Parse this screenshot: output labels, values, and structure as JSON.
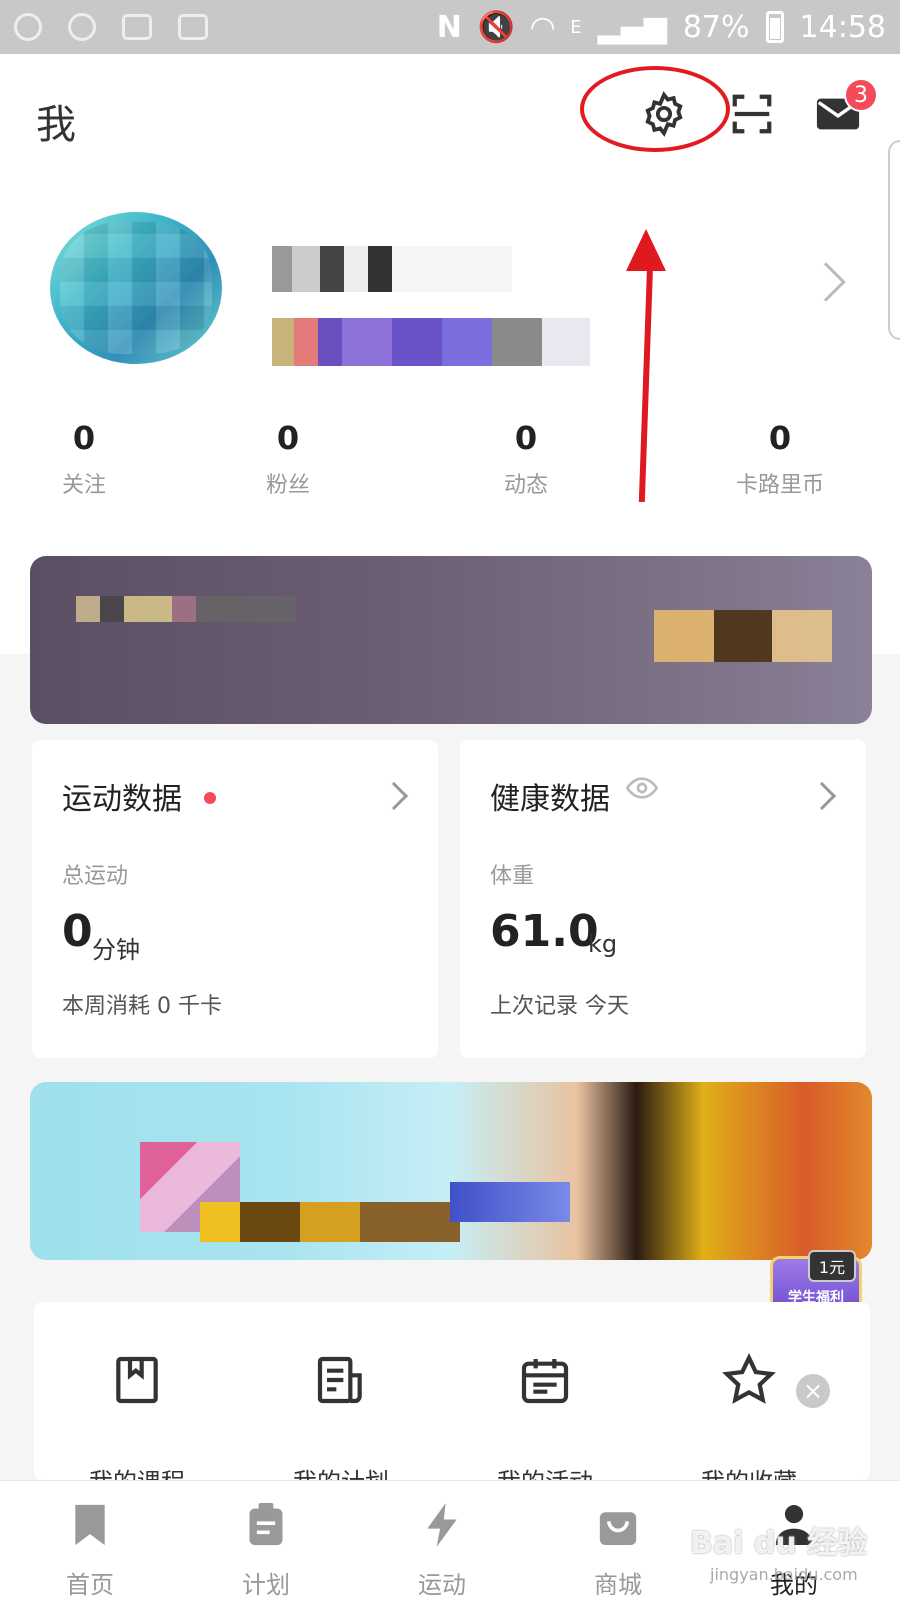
{
  "status_bar": {
    "battery": "87%",
    "time": "14:58",
    "network": "E"
  },
  "header": {
    "title": "我",
    "mail_badge": "3"
  },
  "stats": [
    {
      "value": "0",
      "label": "关注"
    },
    {
      "value": "0",
      "label": "粉丝"
    },
    {
      "value": "0",
      "label": "动态"
    },
    {
      "value": "0",
      "label": "卡路里币"
    }
  ],
  "sport_card": {
    "title": "运动数据",
    "sub_label": "总运动",
    "value": "0",
    "unit": "分钟",
    "footer": "本周消耗 0 千卡"
  },
  "health_card": {
    "title": "健康数据",
    "sub_label": "体重",
    "value": "61.0",
    "unit": "kg",
    "footer": "上次记录 今天"
  },
  "promo": {
    "tag": "学生福利",
    "price": "1元"
  },
  "quick_menu": [
    {
      "label": "我的课程",
      "icon": "bookmark-book-icon"
    },
    {
      "label": "我的计划",
      "icon": "plan-doc-icon"
    },
    {
      "label": "我的活动",
      "icon": "calendar-icon"
    },
    {
      "label": "我的收藏",
      "icon": "star-icon"
    }
  ],
  "bottom_nav": [
    {
      "label": "首页",
      "icon": "bookmark-icon",
      "active": false
    },
    {
      "label": "计划",
      "icon": "clipboard-icon",
      "active": false
    },
    {
      "label": "运动",
      "icon": "lightning-icon",
      "active": false
    },
    {
      "label": "商城",
      "icon": "bag-icon",
      "active": false
    },
    {
      "label": "我的",
      "icon": "person-icon",
      "active": true
    }
  ],
  "watermark": {
    "text": "Bai du 经验",
    "url": "jingyan.baidu.com"
  },
  "colors": {
    "accent_red": "#f44b5b",
    "annotation_red": "#e01820",
    "status_bar_bg": "#c8c8c8"
  }
}
